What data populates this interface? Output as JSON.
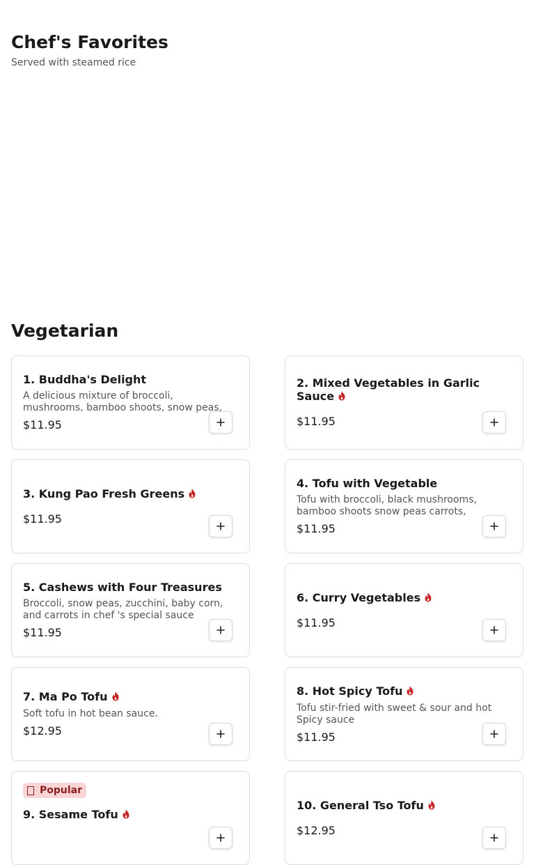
{
  "favorites": {
    "title": "Chef's Favorites",
    "subtitle": "Served with steamed rice"
  },
  "vegetarian": {
    "title": "Vegetarian",
    "items": [
      {
        "name": "1. Buddha's Delight",
        "spicy": false,
        "description": "A delicious mixture of broccoli, mushrooms, bamboo shoots, snow peas, carrots, baby...",
        "price": "$11.95",
        "badge": ""
      },
      {
        "name": "2. Mixed Vegetables in Garlic Sauce",
        "spicy": true,
        "description": "",
        "price": "$11.95",
        "badge": ""
      },
      {
        "name": "3. Kung Pao Fresh Greens",
        "spicy": true,
        "description": "",
        "price": "$11.95",
        "badge": ""
      },
      {
        "name": "4. Tofu with Vegetable",
        "spicy": false,
        "description": "Tofu with broccoli, black mushrooms, bamboo shoots snow peas carrots, baby...",
        "price": "$11.95",
        "badge": ""
      },
      {
        "name": "5. Cashews with Four Treasures",
        "spicy": false,
        "description": "Broccoli, snow peas, zucchini, baby corn, and carrots in chef 's special sauce",
        "price": "$11.95",
        "badge": ""
      },
      {
        "name": "6. Curry Vegetables",
        "spicy": true,
        "description": "",
        "price": "$11.95",
        "badge": ""
      },
      {
        "name": "7. Ma Po Tofu",
        "spicy": true,
        "description": "Soft tofu in hot bean sauce.",
        "price": "$12.95",
        "badge": ""
      },
      {
        "name": "8. Hot Spicy Tofu",
        "spicy": true,
        "description": "Tofu stir-fried with sweet & sour and hot Spicy sauce",
        "price": "$11.95",
        "badge": ""
      },
      {
        "name": "9. Sesame Tofu",
        "spicy": true,
        "description": "",
        "price": "",
        "badge": "Popular"
      },
      {
        "name": "10. General Tso Tofu",
        "spicy": true,
        "description": "",
        "price": "$12.95",
        "badge": ""
      }
    ]
  },
  "icons": {
    "spicy": "chili-flame-icon",
    "add": "plus-icon",
    "popular": "flame-icon"
  },
  "colors": {
    "spicy_red": "#c62828",
    "badge_bg": "#fbd5d5",
    "badge_text": "#8b1f1f"
  }
}
